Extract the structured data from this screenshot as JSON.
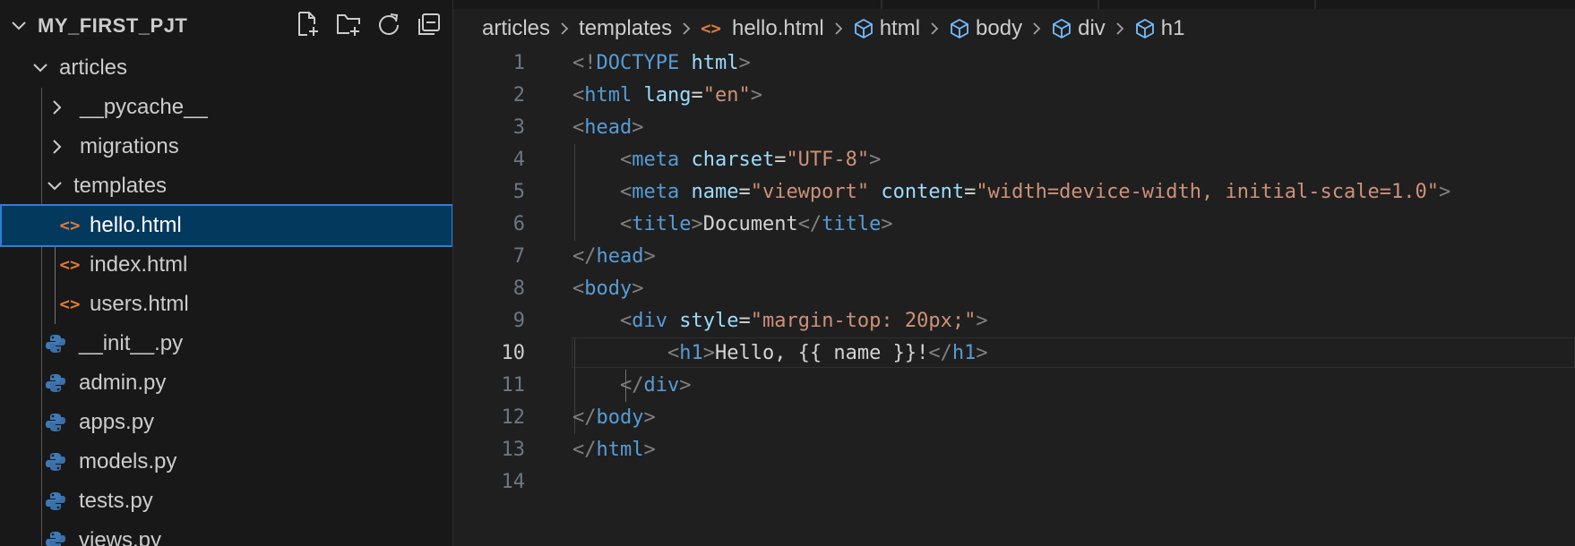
{
  "explorer": {
    "project": "MY_FIRST_PJT",
    "actions": [
      {
        "name": "new-file-icon"
      },
      {
        "name": "new-folder-icon"
      },
      {
        "name": "refresh-icon"
      },
      {
        "name": "collapse-all-icon"
      }
    ],
    "items": [
      {
        "label": "articles",
        "type": "folder",
        "expanded": true
      },
      {
        "label": "__pycache__",
        "type": "folder",
        "expanded": false
      },
      {
        "label": "migrations",
        "type": "folder",
        "expanded": false
      },
      {
        "label": "templates",
        "type": "folder",
        "expanded": true
      },
      {
        "label": "hello.html",
        "type": "html",
        "selected": true
      },
      {
        "label": "index.html",
        "type": "html"
      },
      {
        "label": "users.html",
        "type": "html"
      },
      {
        "label": "__init__.py",
        "type": "python"
      },
      {
        "label": "admin.py",
        "type": "python"
      },
      {
        "label": "apps.py",
        "type": "python"
      },
      {
        "label": "models.py",
        "type": "python"
      },
      {
        "label": "tests.py",
        "type": "python"
      },
      {
        "label": "views.py",
        "type": "python"
      }
    ]
  },
  "breadcrumb": [
    {
      "label": "articles",
      "icon": null
    },
    {
      "label": "templates",
      "icon": null
    },
    {
      "label": "hello.html",
      "icon": "html-file-icon"
    },
    {
      "label": "html",
      "icon": "symbol-element-icon"
    },
    {
      "label": "body",
      "icon": "symbol-element-icon"
    },
    {
      "label": "div",
      "icon": "symbol-element-icon"
    },
    {
      "label": "h1",
      "icon": "symbol-element-icon"
    }
  ],
  "editor": {
    "current_line": 10,
    "lines": [
      {
        "num": "1",
        "tokens": [
          [
            "b",
            "<!"
          ],
          [
            "t",
            "DOCTYPE"
          ],
          [
            "x",
            " "
          ],
          [
            "a",
            "html"
          ],
          [
            "b",
            ">"
          ]
        ]
      },
      {
        "num": "2",
        "tokens": [
          [
            "b",
            "<"
          ],
          [
            "t",
            "html"
          ],
          [
            "x",
            " "
          ],
          [
            "a",
            "lang"
          ],
          [
            "x",
            "="
          ],
          [
            "s",
            "\"en\""
          ],
          [
            "b",
            ">"
          ]
        ]
      },
      {
        "num": "3",
        "tokens": [
          [
            "b",
            "<"
          ],
          [
            "t",
            "head"
          ],
          [
            "b",
            ">"
          ]
        ]
      },
      {
        "num": "4",
        "tokens": [
          [
            "x",
            "    "
          ],
          [
            "b",
            "<"
          ],
          [
            "t",
            "meta"
          ],
          [
            "x",
            " "
          ],
          [
            "a",
            "charset"
          ],
          [
            "x",
            "="
          ],
          [
            "s",
            "\"UTF-8\""
          ],
          [
            "b",
            ">"
          ]
        ]
      },
      {
        "num": "5",
        "tokens": [
          [
            "x",
            "    "
          ],
          [
            "b",
            "<"
          ],
          [
            "t",
            "meta"
          ],
          [
            "x",
            " "
          ],
          [
            "a",
            "name"
          ],
          [
            "x",
            "="
          ],
          [
            "s",
            "\"viewport\""
          ],
          [
            "x",
            " "
          ],
          [
            "a",
            "content"
          ],
          [
            "x",
            "="
          ],
          [
            "s",
            "\"width=device-width, initial-scale=1.0\""
          ],
          [
            "b",
            ">"
          ]
        ]
      },
      {
        "num": "6",
        "tokens": [
          [
            "x",
            "    "
          ],
          [
            "b",
            "<"
          ],
          [
            "t",
            "title"
          ],
          [
            "b",
            ">"
          ],
          [
            "x",
            "Document"
          ],
          [
            "b",
            "</"
          ],
          [
            "t",
            "title"
          ],
          [
            "b",
            ">"
          ]
        ]
      },
      {
        "num": "7",
        "tokens": [
          [
            "b",
            "</"
          ],
          [
            "t",
            "head"
          ],
          [
            "b",
            ">"
          ]
        ]
      },
      {
        "num": "8",
        "tokens": [
          [
            "b",
            "<"
          ],
          [
            "t",
            "body"
          ],
          [
            "b",
            ">"
          ]
        ]
      },
      {
        "num": "9",
        "tokens": [
          [
            "x",
            "    "
          ],
          [
            "b",
            "<"
          ],
          [
            "t",
            "div"
          ],
          [
            "x",
            " "
          ],
          [
            "a",
            "style"
          ],
          [
            "x",
            "="
          ],
          [
            "s",
            "\"margin-top: 20px;\""
          ],
          [
            "b",
            ">"
          ]
        ]
      },
      {
        "num": "10",
        "tokens": [
          [
            "x",
            "        "
          ],
          [
            "b",
            "<"
          ],
          [
            "t",
            "h1"
          ],
          [
            "b",
            ">"
          ],
          [
            "x",
            "Hello, {{ name }}!"
          ],
          [
            "b",
            "</"
          ],
          [
            "t",
            "h1"
          ],
          [
            "b",
            ">"
          ]
        ]
      },
      {
        "num": "11",
        "tokens": [
          [
            "x",
            "    "
          ],
          [
            "b",
            "</"
          ],
          [
            "t",
            "div"
          ],
          [
            "b",
            ">"
          ]
        ]
      },
      {
        "num": "12",
        "tokens": [
          [
            "b",
            "</"
          ],
          [
            "t",
            "body"
          ],
          [
            "b",
            ">"
          ]
        ]
      },
      {
        "num": "13",
        "tokens": [
          [
            "b",
            "</"
          ],
          [
            "t",
            "html"
          ],
          [
            "b",
            ">"
          ]
        ]
      },
      {
        "num": "14",
        "tokens": []
      }
    ]
  },
  "colors": {
    "sidebar_bg": "#181818",
    "editor_bg": "#1f1f1f",
    "selection_bg": "#04395e",
    "selection_border": "#2e7ed7",
    "html_icon": "#e37933",
    "python_blue": "#3e7ab8",
    "python_yellow": "#f2c94c",
    "tag": "#569cd6",
    "attribute": "#9cdcfe",
    "string": "#ce9178",
    "punctuation": "#808080",
    "text": "#d4d4d4"
  }
}
